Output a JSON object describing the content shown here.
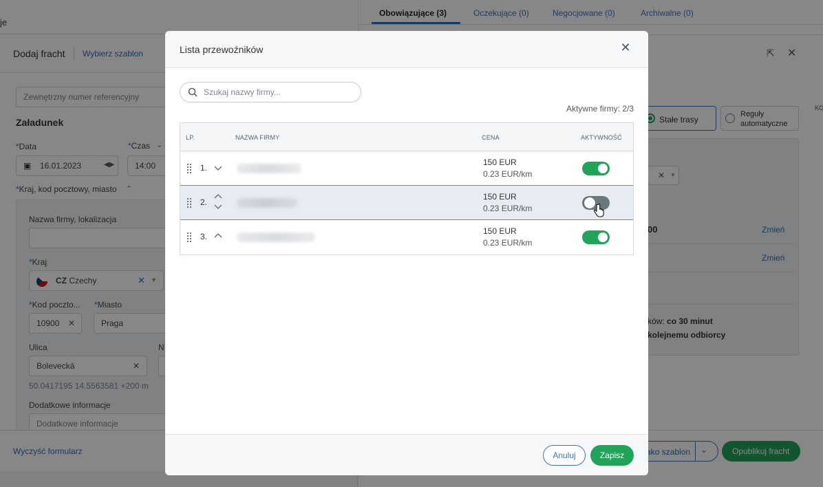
{
  "background": {
    "left": {
      "cut_title": "je",
      "add_freight": "Dodaj fracht",
      "choose_template": "Wybierz szablon",
      "ext_ref_placeholder": "Zewnętrzny numer referencyjny",
      "section": "Załadunek",
      "date_label": "Data",
      "date_value": "16.01.2023",
      "time_label": "Czas",
      "time_value": "14:00",
      "location_toggle": "Kraj, kod pocztowy, miasto",
      "company_label": "Nazwa firmy, lokalizacja",
      "country_label": "Kraj",
      "country_code": "CZ",
      "country_name": "Czechy",
      "postcode_label": "Kod poczto...",
      "postcode_value": "10900",
      "city_label": "Miasto",
      "city_value": "Praga",
      "street_label": "Ulica",
      "street_value": "Bolevecká",
      "number_label_cut": "N",
      "coords": "50.0417195 14.5563581 +200 m",
      "extra_label": "Dodatkowe informacje",
      "extra_placeholder": "Dodatkowe informacje",
      "clear_form": "Wyczyść formularz"
    },
    "right": {
      "tabs": [
        "Obowiązujące (3)",
        "Oczekujące (0)",
        "Negocjowane (0)",
        "Archiwalne (0)"
      ],
      "fixed_routes": "Stałe trasy",
      "auto_rules_1": "Reguły",
      "auto_rules_2": "automatyczne",
      "cut_ko": "KO",
      "cut_00": "00",
      "change": "Zmień",
      "cut_text_1_prefix": "ków: ",
      "cut_text_1_bold": "co 30 minut",
      "cut_text_2": "kolejnemu odbiorcy",
      "as_template": "ako szablon",
      "publish": "Opublikuj fracht"
    }
  },
  "modal": {
    "title": "Lista przewoźników",
    "search_placeholder": "Szukaj nazwy firmy...",
    "active_count": "Aktywne firmy: 2/3",
    "headers": {
      "lp": "LP.",
      "name": "NAZWA FIRMY",
      "price": "CENA",
      "active": "AKTYWNOŚĆ"
    },
    "rows": [
      {
        "lp": "1.",
        "price": "150 EUR",
        "rate": "0.23 EUR/km",
        "active": true
      },
      {
        "lp": "2.",
        "price": "150 EUR",
        "rate": "0.23 EUR/km",
        "active": false
      },
      {
        "lp": "3.",
        "price": "150 EUR",
        "rate": "0.23 EUR/km",
        "active": true
      }
    ],
    "cancel": "Anuluj",
    "save": "Zapisz"
  },
  "colors": {
    "accent": "#2f6db5",
    "success": "#22a35a",
    "toggle_off": "#6d7780"
  }
}
